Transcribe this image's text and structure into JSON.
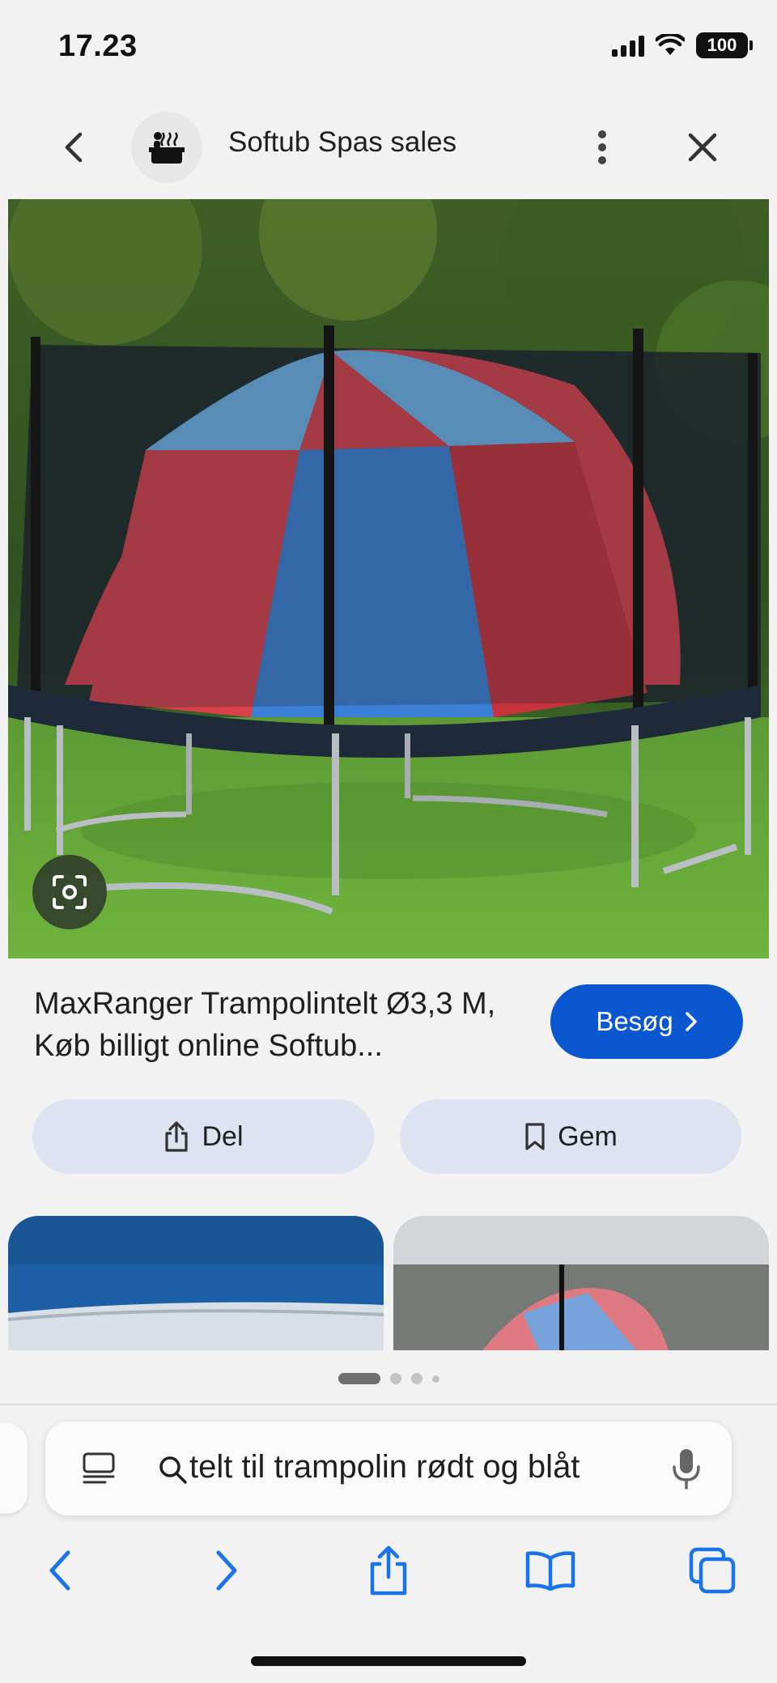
{
  "status_bar": {
    "time": "17.23",
    "battery": "100"
  },
  "header": {
    "site_name": "Softub Spas sales",
    "icons": [
      "back-icon",
      "hot-tub-icon",
      "more-vert-icon",
      "close-icon"
    ]
  },
  "result": {
    "title": "MaxRanger Trampolintelt Ø3,3 M, Køb billigt online Softub...",
    "visit_label": "Besøg",
    "share_label": "Del",
    "save_label": "Gem",
    "lens_icon": "google-lens-icon"
  },
  "pager": {
    "pages": 4,
    "active": 1
  },
  "browser": {
    "address_text": "telt til trampolin rødt og blåt",
    "toolbar_icons": [
      "back-icon",
      "forward-icon",
      "share-icon",
      "bookmarks-icon",
      "tabs-icon"
    ]
  },
  "colors": {
    "accent": "#0b57d0",
    "chip_bg": "#dde3f0",
    "tent_red": "#d9404a",
    "tent_blue": "#3c7fd6",
    "tent_light_blue": "#6eb2ea"
  }
}
